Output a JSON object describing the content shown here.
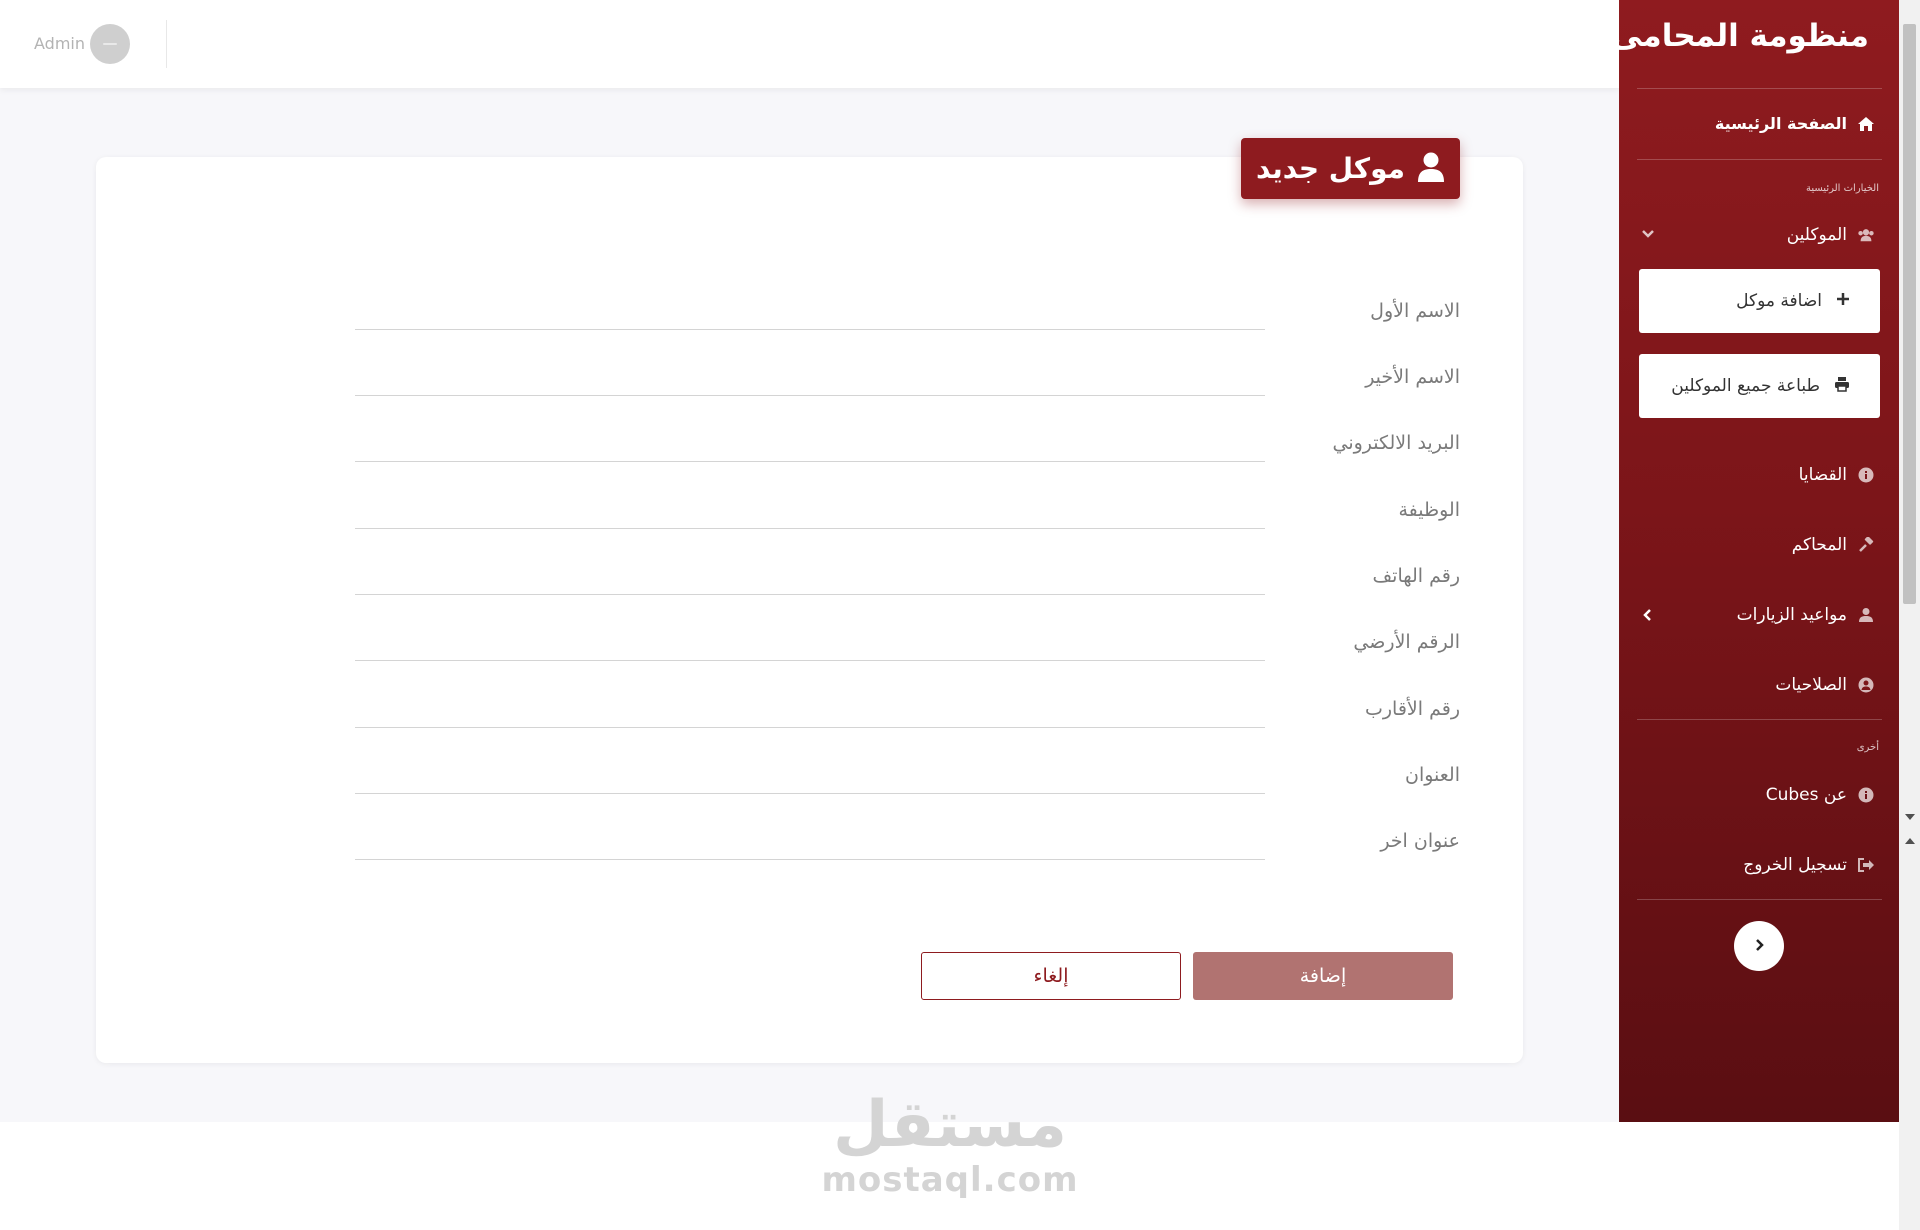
{
  "topbar": {
    "user_label": "Admin"
  },
  "form": {
    "title": "موكل جديد",
    "fields": [
      {
        "label": "الاسم الأول",
        "value": "",
        "placeholder": ""
      },
      {
        "label": "الاسم الأخير",
        "value": "",
        "placeholder": ""
      },
      {
        "label": "البريد الالكتروني",
        "value": "",
        "placeholder": ""
      },
      {
        "label": "الوظيفة",
        "value": "",
        "placeholder": ""
      },
      {
        "label": "رقم الهاتف",
        "value": "",
        "placeholder": ""
      },
      {
        "label": "الرقم الأرضي",
        "value": "",
        "placeholder": ""
      },
      {
        "label": "رقم الأقارب",
        "value": "",
        "placeholder": ""
      },
      {
        "label": "العنوان",
        "value": "",
        "placeholder": ""
      },
      {
        "label": "عنوان اخر",
        "value": "",
        "placeholder": ""
      }
    ],
    "submit_label": "إضافة",
    "cancel_label": "إلغاء"
  },
  "sidebar": {
    "title": "منظومة المحامى",
    "home": {
      "label": "الصفحة الرئيسية",
      "icon": "home-icon"
    },
    "section_main": "الخيارات الرئيسية",
    "clients": {
      "label": "الموكلين",
      "icon": "users-icon",
      "expanded": true
    },
    "add_client": {
      "label": "اضافة موكل",
      "icon": "plus-icon"
    },
    "print_clients": {
      "label": "طباعة جميع الموكلين",
      "icon": "print-icon"
    },
    "cases": {
      "label": "القضايا",
      "icon": "info-circle-icon"
    },
    "courts": {
      "label": "المحاكم",
      "icon": "gavel-icon"
    },
    "visits": {
      "label": "مواعيد الزيارات",
      "icon": "user-icon"
    },
    "permissions": {
      "label": "الصلاحيات",
      "icon": "user-circle-icon"
    },
    "section_other": "أخرى",
    "about": {
      "label": "عن Cubes",
      "icon": "info-circle-icon"
    },
    "logout": {
      "label": "تسجيل الخروج",
      "icon": "sign-out-icon"
    }
  },
  "watermark": {
    "arabic": "مستقل",
    "latin": "mostaql.com"
  },
  "colors": {
    "brand": "#8e1b1f",
    "submit_bg": "#b17371",
    "page_bg": "#f7f7fa"
  }
}
